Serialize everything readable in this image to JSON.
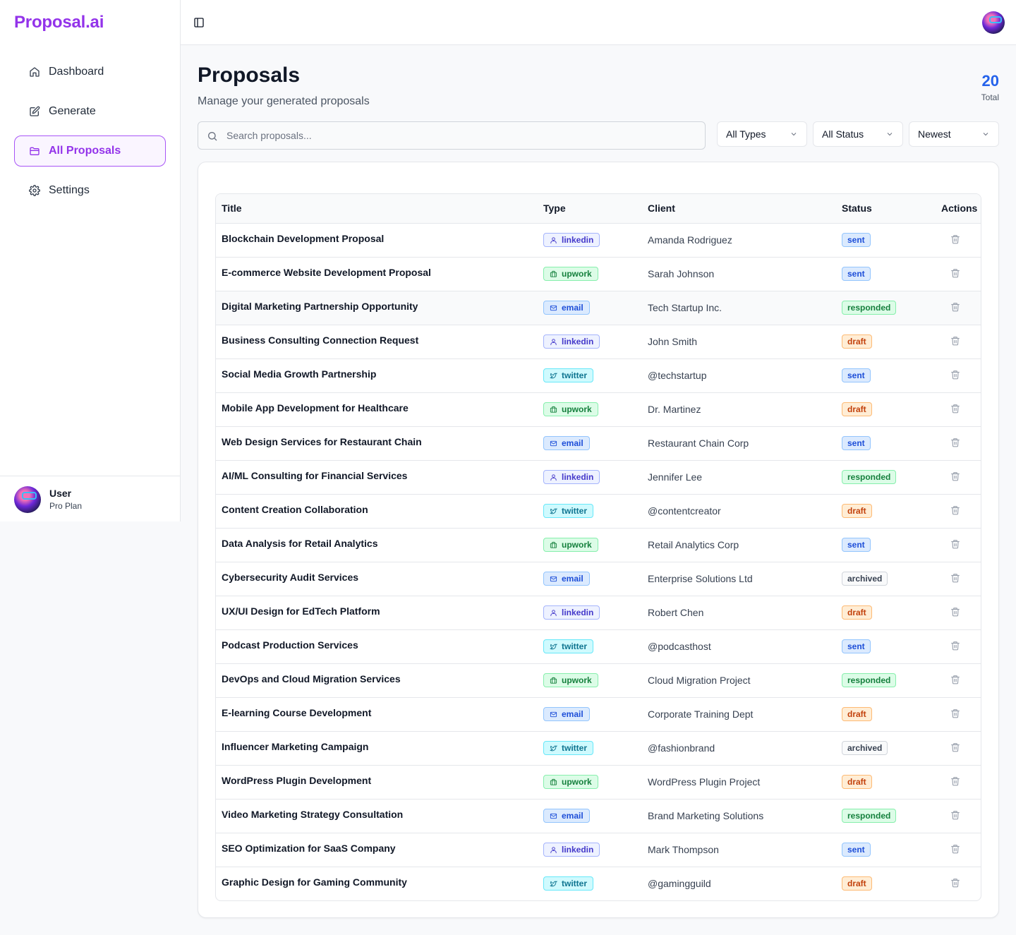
{
  "app": {
    "title": "Proposal.ai"
  },
  "sidebar": {
    "items": [
      {
        "label": "Dashboard",
        "icon": "home-icon",
        "active": false
      },
      {
        "label": "Generate",
        "icon": "edit-icon",
        "active": false
      },
      {
        "label": "All Proposals",
        "icon": "folder-icon",
        "active": true
      },
      {
        "label": "Settings",
        "icon": "gear-icon",
        "active": false
      }
    ],
    "user": {
      "name": "User",
      "plan": "Pro Plan"
    }
  },
  "page": {
    "title": "Proposals",
    "subtitle": "Manage your generated proposals",
    "total": {
      "value": "20",
      "label": "Total"
    }
  },
  "filters": {
    "search_placeholder": "Search proposals...",
    "type_select": "All Types",
    "status_select": "All Status",
    "sort_select": "Newest"
  },
  "table": {
    "headers": {
      "title": "Title",
      "type": "Type",
      "client": "Client",
      "status": "Status",
      "actions": "Actions"
    },
    "rows": [
      {
        "title": "Blockchain Development Proposal",
        "type": "linkedin",
        "client": "Amanda Rodriguez",
        "status": "sent"
      },
      {
        "title": "E-commerce Website Development Proposal",
        "type": "upwork",
        "client": "Sarah Johnson",
        "status": "sent"
      },
      {
        "title": "Digital Marketing Partnership Opportunity",
        "type": "email",
        "client": "Tech Startup Inc.",
        "status": "responded"
      },
      {
        "title": "Business Consulting Connection Request",
        "type": "linkedin",
        "client": "John Smith",
        "status": "draft"
      },
      {
        "title": "Social Media Growth Partnership",
        "type": "twitter",
        "client": "@techstartup",
        "status": "sent"
      },
      {
        "title": "Mobile App Development for Healthcare",
        "type": "upwork",
        "client": "Dr. Martinez",
        "status": "draft"
      },
      {
        "title": "Web Design Services for Restaurant Chain",
        "type": "email",
        "client": "Restaurant Chain Corp",
        "status": "sent"
      },
      {
        "title": "AI/ML Consulting for Financial Services",
        "type": "linkedin",
        "client": "Jennifer Lee",
        "status": "responded"
      },
      {
        "title": "Content Creation Collaboration",
        "type": "twitter",
        "client": "@contentcreator",
        "status": "draft"
      },
      {
        "title": "Data Analysis for Retail Analytics",
        "type": "upwork",
        "client": "Retail Analytics Corp",
        "status": "sent"
      },
      {
        "title": "Cybersecurity Audit Services",
        "type": "email",
        "client": "Enterprise Solutions Ltd",
        "status": "archived"
      },
      {
        "title": "UX/UI Design for EdTech Platform",
        "type": "linkedin",
        "client": "Robert Chen",
        "status": "draft"
      },
      {
        "title": "Podcast Production Services",
        "type": "twitter",
        "client": "@podcasthost",
        "status": "sent"
      },
      {
        "title": "DevOps and Cloud Migration Services",
        "type": "upwork",
        "client": "Cloud Migration Project",
        "status": "responded"
      },
      {
        "title": "E-learning Course Development",
        "type": "email",
        "client": "Corporate Training Dept",
        "status": "draft"
      },
      {
        "title": "Influencer Marketing Campaign",
        "type": "twitter",
        "client": "@fashionbrand",
        "status": "archived"
      },
      {
        "title": "WordPress Plugin Development",
        "type": "upwork",
        "client": "WordPress Plugin Project",
        "status": "draft"
      },
      {
        "title": "Video Marketing Strategy Consultation",
        "type": "email",
        "client": "Brand Marketing Solutions",
        "status": "responded"
      },
      {
        "title": "SEO Optimization for SaaS Company",
        "type": "linkedin",
        "client": "Mark Thompson",
        "status": "sent"
      },
      {
        "title": "Graphic Design for Gaming Community",
        "type": "twitter",
        "client": "@gamingguild",
        "status": "draft"
      }
    ]
  },
  "colors": {
    "brand": "#9333ea",
    "accent": "#2563eb"
  }
}
